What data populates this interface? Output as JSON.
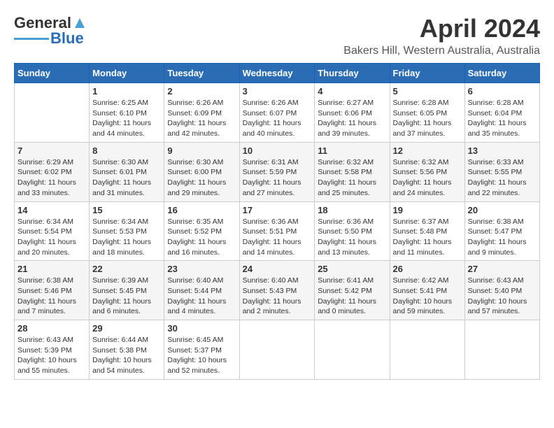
{
  "app": {
    "logo_general": "General",
    "logo_blue": "Blue",
    "title": "April 2024",
    "subtitle": "Bakers Hill, Western Australia, Australia"
  },
  "calendar": {
    "headers": [
      "Sunday",
      "Monday",
      "Tuesday",
      "Wednesday",
      "Thursday",
      "Friday",
      "Saturday"
    ],
    "weeks": [
      [
        {
          "day": "",
          "info": ""
        },
        {
          "day": "1",
          "info": "Sunrise: 6:25 AM\nSunset: 6:10 PM\nDaylight: 11 hours\nand 44 minutes."
        },
        {
          "day": "2",
          "info": "Sunrise: 6:26 AM\nSunset: 6:09 PM\nDaylight: 11 hours\nand 42 minutes."
        },
        {
          "day": "3",
          "info": "Sunrise: 6:26 AM\nSunset: 6:07 PM\nDaylight: 11 hours\nand 40 minutes."
        },
        {
          "day": "4",
          "info": "Sunrise: 6:27 AM\nSunset: 6:06 PM\nDaylight: 11 hours\nand 39 minutes."
        },
        {
          "day": "5",
          "info": "Sunrise: 6:28 AM\nSunset: 6:05 PM\nDaylight: 11 hours\nand 37 minutes."
        },
        {
          "day": "6",
          "info": "Sunrise: 6:28 AM\nSunset: 6:04 PM\nDaylight: 11 hours\nand 35 minutes."
        }
      ],
      [
        {
          "day": "7",
          "info": "Sunrise: 6:29 AM\nSunset: 6:02 PM\nDaylight: 11 hours\nand 33 minutes."
        },
        {
          "day": "8",
          "info": "Sunrise: 6:30 AM\nSunset: 6:01 PM\nDaylight: 11 hours\nand 31 minutes."
        },
        {
          "day": "9",
          "info": "Sunrise: 6:30 AM\nSunset: 6:00 PM\nDaylight: 11 hours\nand 29 minutes."
        },
        {
          "day": "10",
          "info": "Sunrise: 6:31 AM\nSunset: 5:59 PM\nDaylight: 11 hours\nand 27 minutes."
        },
        {
          "day": "11",
          "info": "Sunrise: 6:32 AM\nSunset: 5:58 PM\nDaylight: 11 hours\nand 25 minutes."
        },
        {
          "day": "12",
          "info": "Sunrise: 6:32 AM\nSunset: 5:56 PM\nDaylight: 11 hours\nand 24 minutes."
        },
        {
          "day": "13",
          "info": "Sunrise: 6:33 AM\nSunset: 5:55 PM\nDaylight: 11 hours\nand 22 minutes."
        }
      ],
      [
        {
          "day": "14",
          "info": "Sunrise: 6:34 AM\nSunset: 5:54 PM\nDaylight: 11 hours\nand 20 minutes."
        },
        {
          "day": "15",
          "info": "Sunrise: 6:34 AM\nSunset: 5:53 PM\nDaylight: 11 hours\nand 18 minutes."
        },
        {
          "day": "16",
          "info": "Sunrise: 6:35 AM\nSunset: 5:52 PM\nDaylight: 11 hours\nand 16 minutes."
        },
        {
          "day": "17",
          "info": "Sunrise: 6:36 AM\nSunset: 5:51 PM\nDaylight: 11 hours\nand 14 minutes."
        },
        {
          "day": "18",
          "info": "Sunrise: 6:36 AM\nSunset: 5:50 PM\nDaylight: 11 hours\nand 13 minutes."
        },
        {
          "day": "19",
          "info": "Sunrise: 6:37 AM\nSunset: 5:48 PM\nDaylight: 11 hours\nand 11 minutes."
        },
        {
          "day": "20",
          "info": "Sunrise: 6:38 AM\nSunset: 5:47 PM\nDaylight: 11 hours\nand 9 minutes."
        }
      ],
      [
        {
          "day": "21",
          "info": "Sunrise: 6:38 AM\nSunset: 5:46 PM\nDaylight: 11 hours\nand 7 minutes."
        },
        {
          "day": "22",
          "info": "Sunrise: 6:39 AM\nSunset: 5:45 PM\nDaylight: 11 hours\nand 6 minutes."
        },
        {
          "day": "23",
          "info": "Sunrise: 6:40 AM\nSunset: 5:44 PM\nDaylight: 11 hours\nand 4 minutes."
        },
        {
          "day": "24",
          "info": "Sunrise: 6:40 AM\nSunset: 5:43 PM\nDaylight: 11 hours\nand 2 minutes."
        },
        {
          "day": "25",
          "info": "Sunrise: 6:41 AM\nSunset: 5:42 PM\nDaylight: 11 hours\nand 0 minutes."
        },
        {
          "day": "26",
          "info": "Sunrise: 6:42 AM\nSunset: 5:41 PM\nDaylight: 10 hours\nand 59 minutes."
        },
        {
          "day": "27",
          "info": "Sunrise: 6:43 AM\nSunset: 5:40 PM\nDaylight: 10 hours\nand 57 minutes."
        }
      ],
      [
        {
          "day": "28",
          "info": "Sunrise: 6:43 AM\nSunset: 5:39 PM\nDaylight: 10 hours\nand 55 minutes."
        },
        {
          "day": "29",
          "info": "Sunrise: 6:44 AM\nSunset: 5:38 PM\nDaylight: 10 hours\nand 54 minutes."
        },
        {
          "day": "30",
          "info": "Sunrise: 6:45 AM\nSunset: 5:37 PM\nDaylight: 10 hours\nand 52 minutes."
        },
        {
          "day": "",
          "info": ""
        },
        {
          "day": "",
          "info": ""
        },
        {
          "day": "",
          "info": ""
        },
        {
          "day": "",
          "info": ""
        }
      ]
    ]
  }
}
